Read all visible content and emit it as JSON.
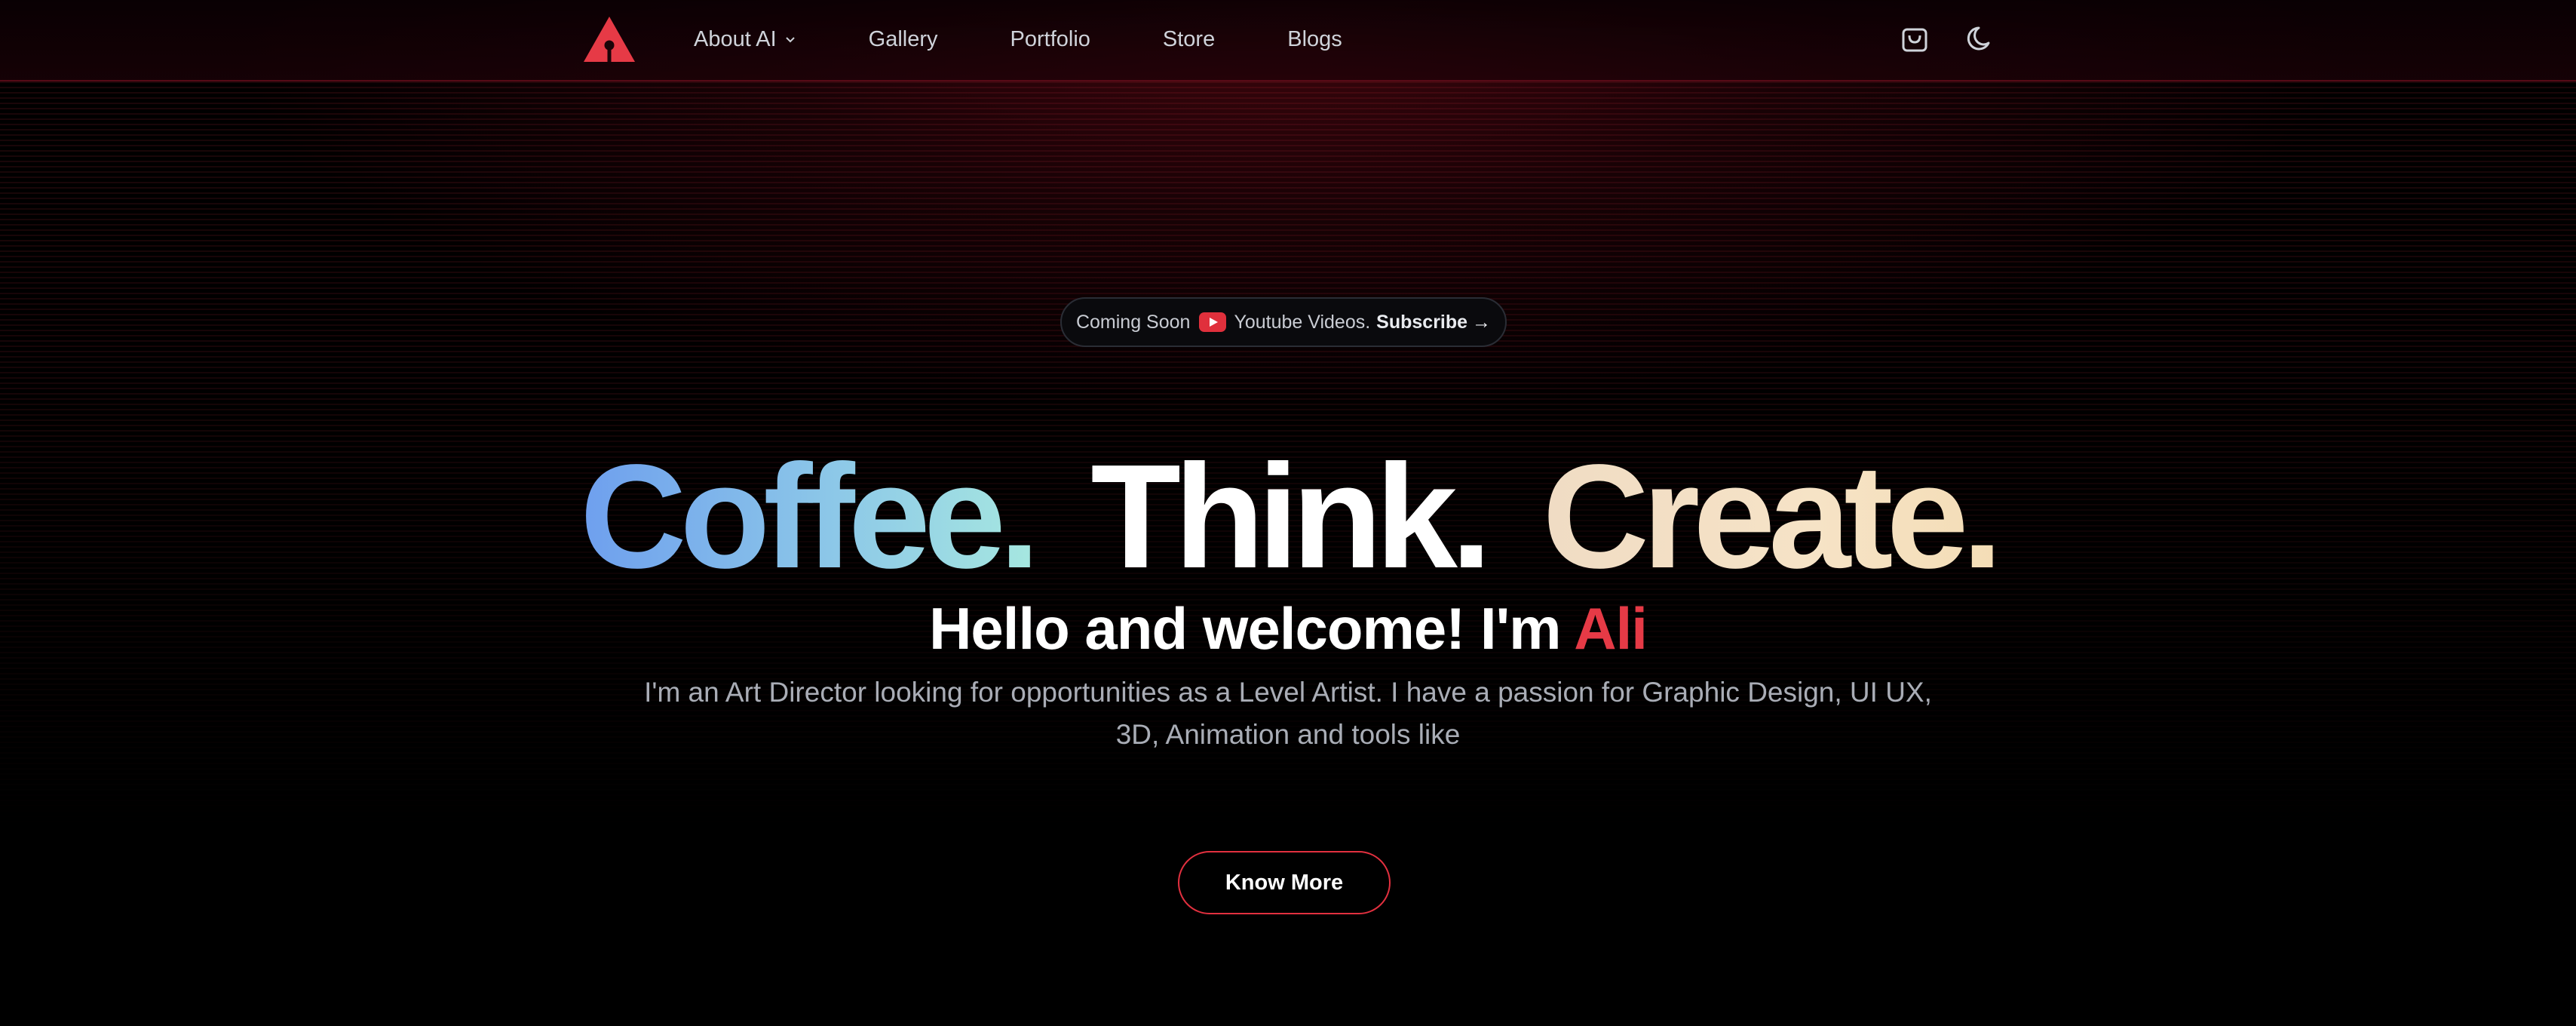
{
  "colors": {
    "accent": "#e63a46",
    "background": "#000000",
    "nav_text": "#cfd3da",
    "coffee_gradient": [
      "#6e9fee",
      "#a6e7e0"
    ],
    "create_gradient": [
      "#f0dcc4",
      "#f4ddb6"
    ]
  },
  "nav": {
    "logo_icon": "triangle-keyhole-logo",
    "links": [
      {
        "label": "About AI",
        "has_dropdown": true
      },
      {
        "label": "Gallery"
      },
      {
        "label": "Portfolio"
      },
      {
        "label": "Store"
      },
      {
        "label": "Blogs"
      }
    ],
    "icons": [
      "shopping-bag-icon",
      "moon-icon"
    ]
  },
  "badge": {
    "prefix": "Coming Soon",
    "icon": "youtube-icon",
    "text": "Youtube Videos.",
    "cta": "Subscribe",
    "arrow": "→"
  },
  "hero": {
    "words": [
      "Coffee.",
      "Think.",
      "Create."
    ],
    "greeting": "Hello and welcome! I'm",
    "name": "Ali",
    "bio": "I'm an Art Director looking for opportunities as a Level Artist. I have a passion for Graphic Design, UI UX, 3D, Animation and tools like",
    "button_label": "Know More"
  }
}
